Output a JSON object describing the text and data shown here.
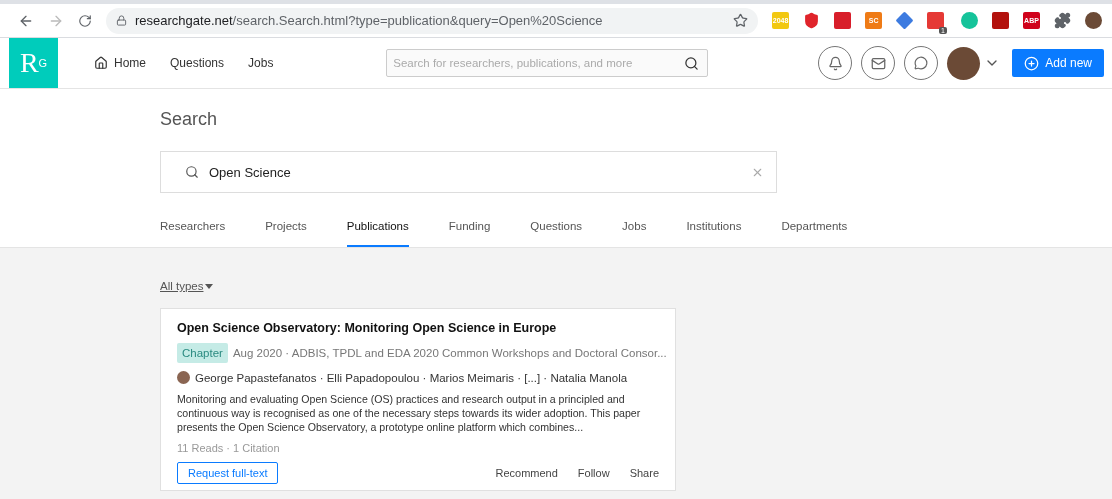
{
  "browser": {
    "url_domain": "researchgate.net",
    "url_path": "/search.Search.html?type=publication&query=Open%20Science",
    "extensions": [
      {
        "kind": "text",
        "label": "2048",
        "color": "#f2c811"
      },
      {
        "kind": "shield",
        "color": "#e0242b"
      },
      {
        "kind": "plain",
        "color": "#d81e2a"
      },
      {
        "kind": "text",
        "label": "SC",
        "color": "#ef7b16"
      },
      {
        "kind": "cap",
        "color": "#3d7be0"
      },
      {
        "kind": "badge",
        "label": "1",
        "color": "#e53935"
      },
      {
        "kind": "circle",
        "color": "#15c39a"
      },
      {
        "kind": "plain",
        "color": "#b3120d"
      },
      {
        "kind": "text",
        "label": "ABP",
        "color": "#d0021b"
      },
      {
        "kind": "puzzle",
        "color": "#5f6368"
      },
      {
        "kind": "avatar",
        "color": "#6b4a36"
      }
    ]
  },
  "header": {
    "logo": "R",
    "logo_sup": "G",
    "nav": [
      {
        "label": "Home"
      },
      {
        "label": "Questions"
      },
      {
        "label": "Jobs"
      }
    ],
    "search_placeholder": "Search for researchers, publications, and more",
    "add_button": "Add new"
  },
  "page_title": "Search",
  "search": {
    "value": "Open Science"
  },
  "tabs": [
    {
      "label": "Researchers",
      "selected": false
    },
    {
      "label": "Projects",
      "selected": false
    },
    {
      "label": "Publications",
      "selected": true
    },
    {
      "label": "Funding",
      "selected": false
    },
    {
      "label": "Questions",
      "selected": false
    },
    {
      "label": "Jobs",
      "selected": false
    },
    {
      "label": "Institutions",
      "selected": false
    },
    {
      "label": "Departments",
      "selected": false
    }
  ],
  "filter": "All types",
  "results": [
    {
      "title": "Open Science Observatory: Monitoring Open Science in Europe",
      "type": "Chapter",
      "meta": "Aug 2020 · ADBIS, TPDL and EDA 2020 Common Workshops and Doctoral Consor...",
      "authors": "George Papastefanatos · Elli Papadopoulou · Marios Meimaris · [...] · Natalia Manola",
      "abstract": "Monitoring and evaluating Open Science (OS) practices and research output in a principled and continuous way is recognised as one of the necessary steps towards its wider adoption. This paper presents the Open Science Observatory, a prototype online platform which combines...",
      "stats": "11 Reads · 1 Citation",
      "request": "Request full-text",
      "actions": [
        "Recommend",
        "Follow",
        "Share"
      ]
    }
  ]
}
